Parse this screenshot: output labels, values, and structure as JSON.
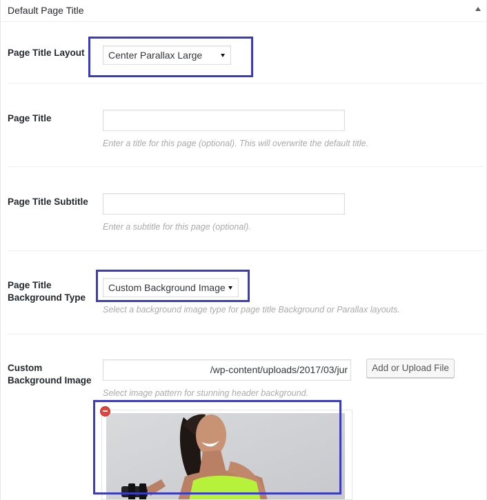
{
  "panel": {
    "title": "Default Page Title"
  },
  "fields": {
    "layout": {
      "label": "Page Title Layout",
      "selected": "Center Parallax Large"
    },
    "title": {
      "label": "Page Title",
      "value": "",
      "description": "Enter a title for this page (optional). This will overwrite the default title."
    },
    "subtitle": {
      "label": "Page Title Subtitle",
      "value": "",
      "description": "Enter a subtitle for this page (optional)."
    },
    "background_type": {
      "label_line1": "Page Title",
      "label_line2": "Background Type",
      "selected": "Custom Background Image",
      "description": "Select a background image type for page title Background or Parallax layouts."
    },
    "background_image": {
      "label_line1": "Custom",
      "label_line2": "Background Image",
      "value": "/wp-content/uploads/2017/03/jur",
      "button_label": "Add or Upload File",
      "description": "Select image pattern for stunning header background."
    }
  },
  "colors": {
    "highlight": "#3b3bbd",
    "remove": "#e0453c",
    "tank_top": "#b6f23a"
  },
  "icons": {
    "collapse": "triangle-up-icon",
    "remove": "remove-circle-icon"
  }
}
